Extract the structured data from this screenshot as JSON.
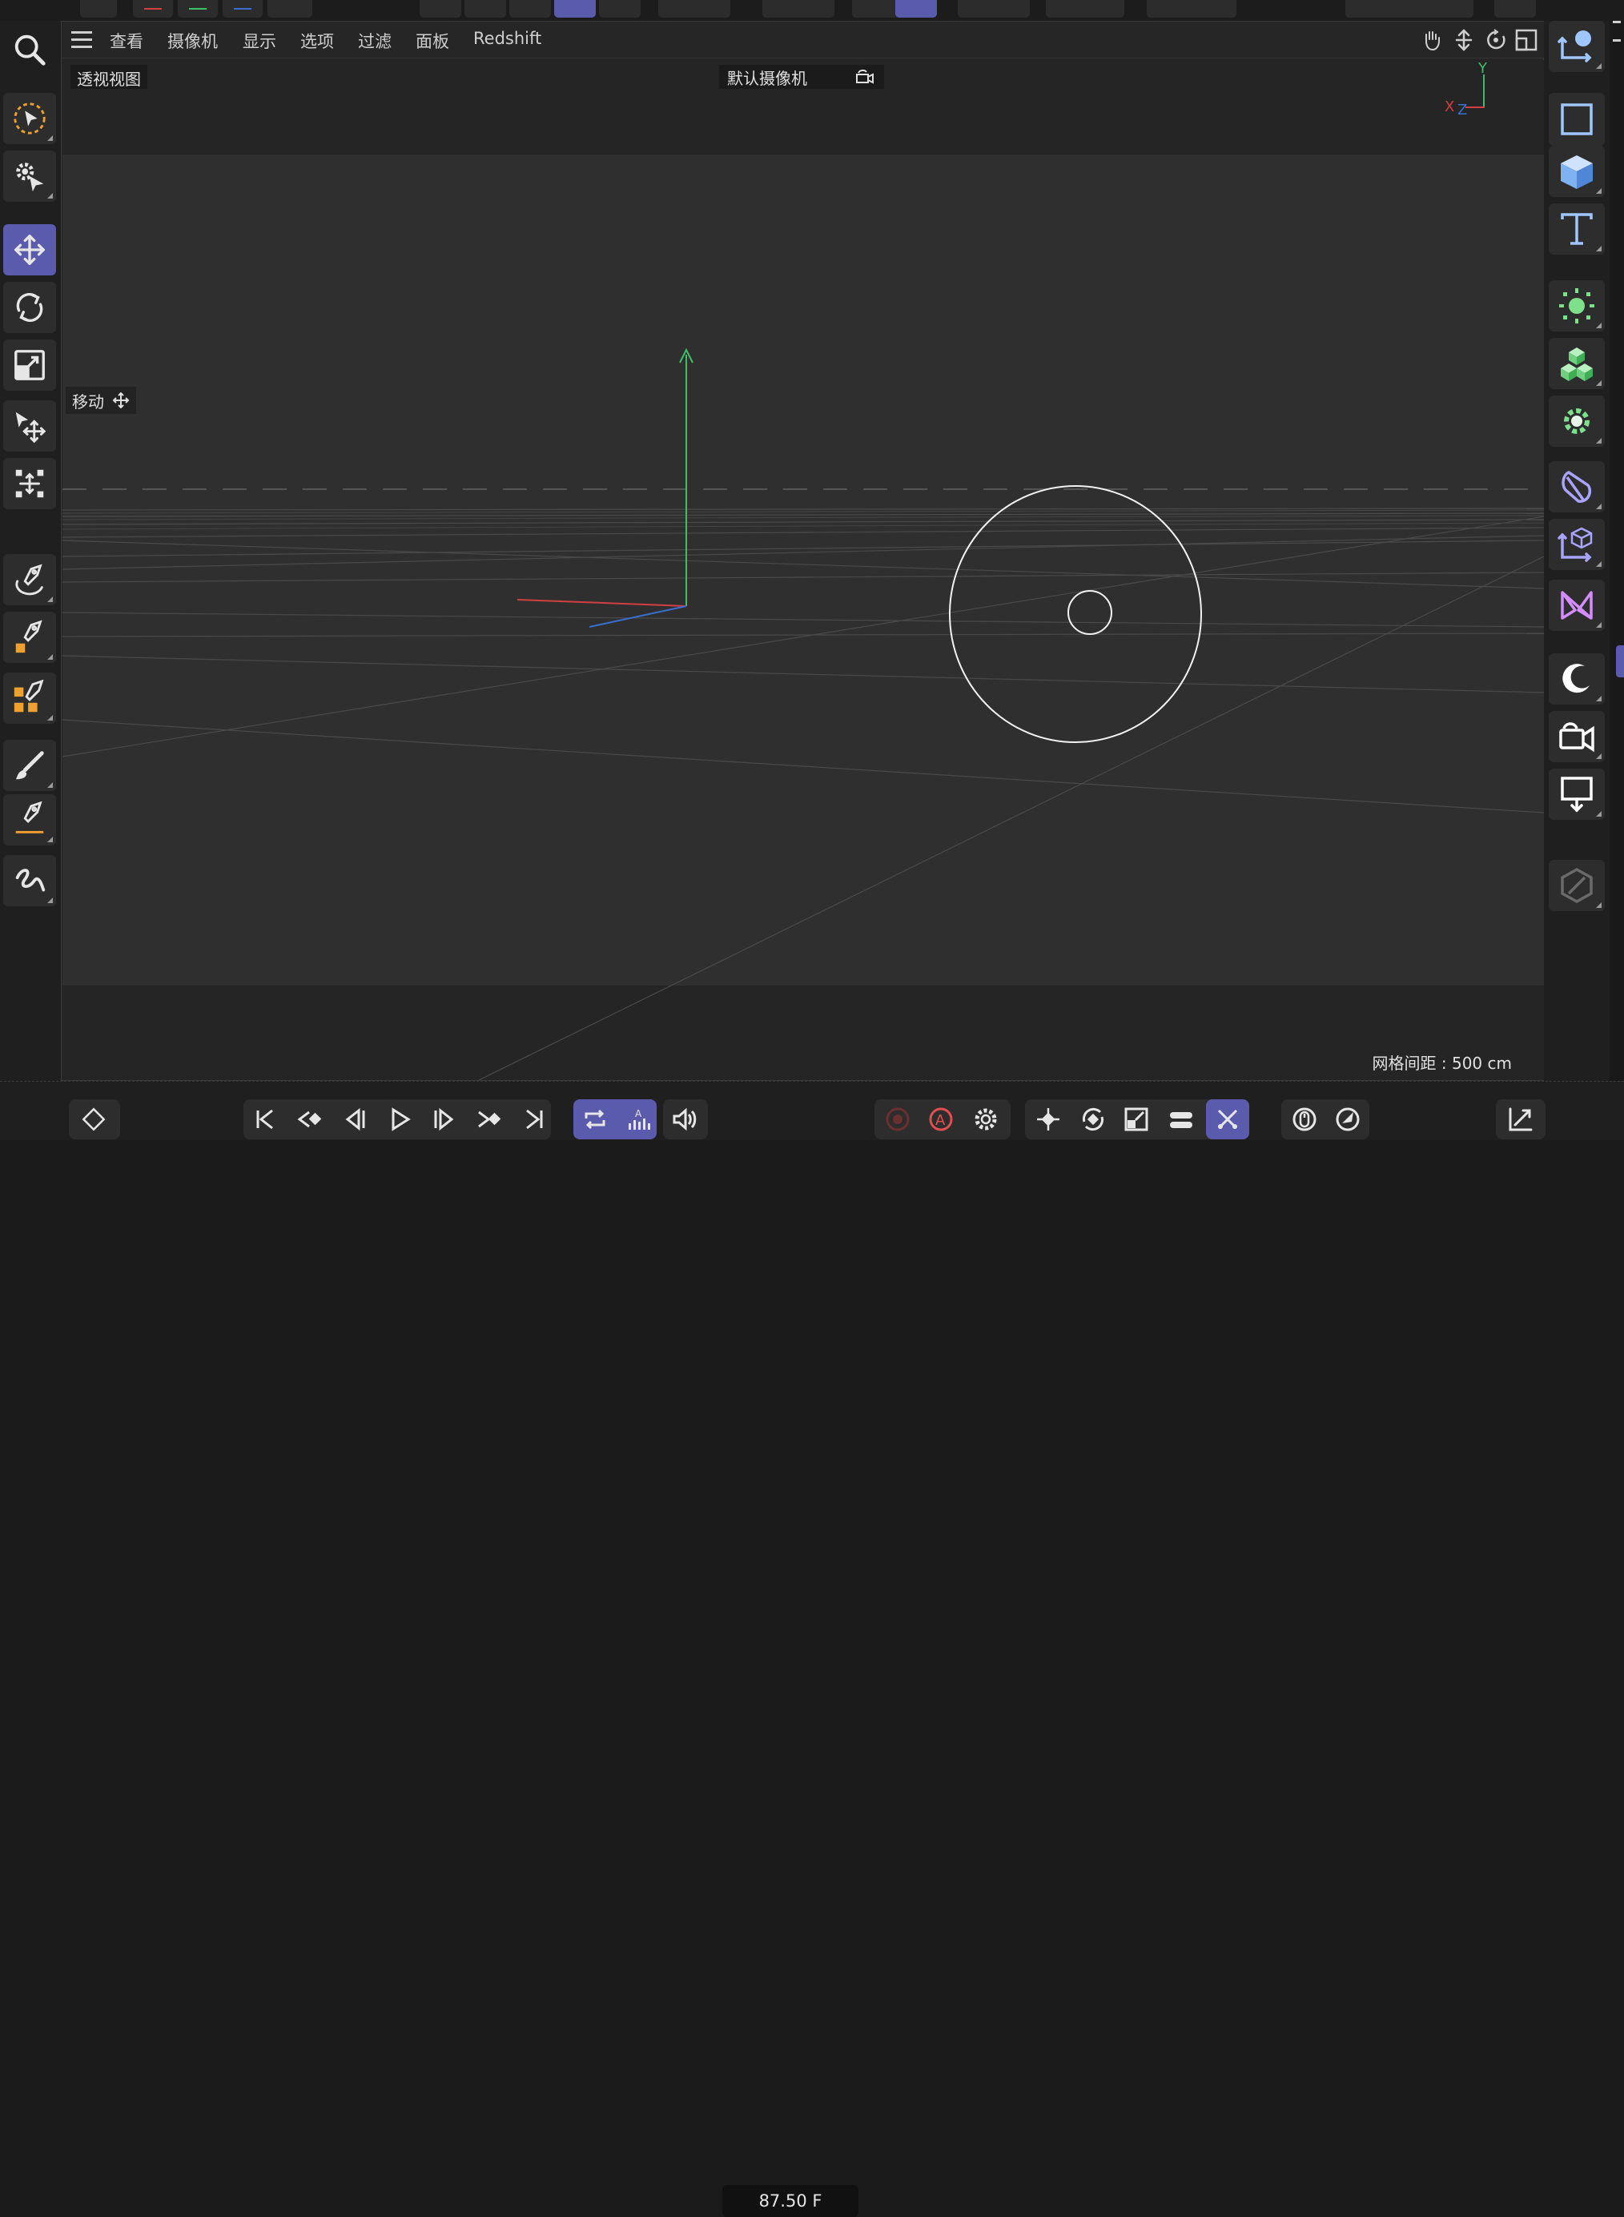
{
  "menu": {
    "hamburger": "menu-icon",
    "items": [
      "查看",
      "摄像机",
      "显示",
      "选项",
      "过滤",
      "面板",
      "Redshift"
    ]
  },
  "viewport": {
    "title": "透视视图",
    "camera": "默认摄像机",
    "move_label": "移动",
    "grid_spacing": "网格间距 : 500 cm",
    "axis_labels": {
      "y": "Y",
      "x": "X",
      "z": "Z"
    }
  },
  "left_tools": [
    "search-icon",
    "live-selection-icon",
    "tweak-icon",
    "move-icon",
    "rotate-icon",
    "scale-icon",
    "transfer-move-icon",
    "multi-move-icon",
    "pen-arc-icon",
    "pen-fill-icon",
    "pen-cubes-icon",
    "brush-icon",
    "pen-line-icon",
    "spline-sketch-icon"
  ],
  "right_tools": [
    "null-object-icon",
    "rectangle-spline-icon",
    "cube-icon",
    "text-icon",
    "cloner-icon",
    "voronoi-cubes-icon",
    "effector-gear-icon",
    "deformer-icon",
    "field-object-icon",
    "scene-node-icon",
    "sky-light-icon",
    "camera-icon",
    "floor-icon",
    "tag-icon"
  ],
  "timeline": {
    "frame": "87.50 F",
    "tools": [
      "keyframe-icon",
      "go-start-icon",
      "prev-key-icon",
      "prev-frame-icon",
      "play-icon",
      "next-frame-icon",
      "next-key-icon",
      "go-end-icon",
      "loop-icon",
      "dopesheet-icon",
      "sound-icon",
      "record-icon",
      "autokey-icon",
      "key-settings-icon",
      "key-pos-icon",
      "key-rot-icon",
      "key-scale-icon",
      "key-param-icon",
      "key-pla-icon",
      "motion-icon",
      "ghost-icon",
      "expand-icon"
    ]
  },
  "colors": {
    "accent": "#5b5bad",
    "axis_x": "#d04040",
    "axis_y": "#3fbf6a",
    "axis_z": "#3a6fd0"
  }
}
